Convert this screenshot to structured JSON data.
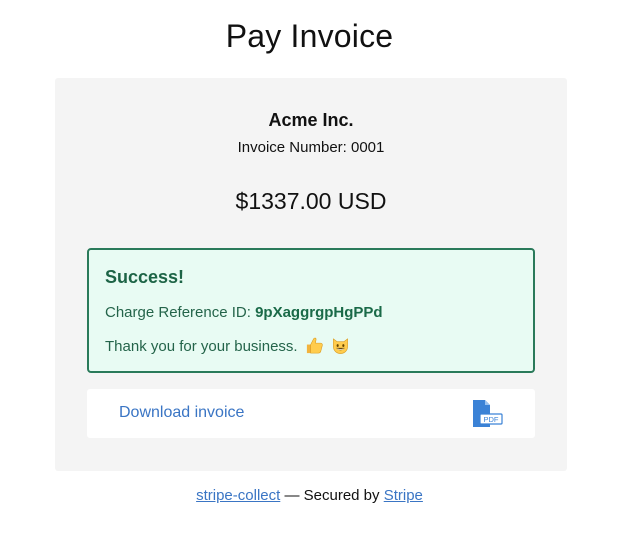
{
  "page": {
    "title": "Pay Invoice"
  },
  "invoice": {
    "company": "Acme Inc.",
    "invoice_number_label": "Invoice Number:",
    "invoice_number": "0001",
    "amount": "$1337.00 USD"
  },
  "success": {
    "title": "Success!",
    "charge_label": "Charge Reference ID:",
    "charge_id": "9pXaggrgpHgPPd",
    "thanks_text": "Thank you for your business.",
    "emoji_icons": [
      "thumbs-up-icon",
      "grinning-cat-icon"
    ]
  },
  "download": {
    "label": "Download invoice",
    "icon": "pdf-file-icon",
    "icon_text": "PDF"
  },
  "footer": {
    "project_link": "stripe-collect",
    "separator": "—",
    "secured_text": "Secured by",
    "stripe_link": "Stripe"
  },
  "colors": {
    "link": "#3a75c4",
    "success_border": "#2a7a5a",
    "success_bg": "#e8fbf3",
    "card_bg": "#f4f4f4",
    "pdf_icon": "#3b82d6"
  }
}
